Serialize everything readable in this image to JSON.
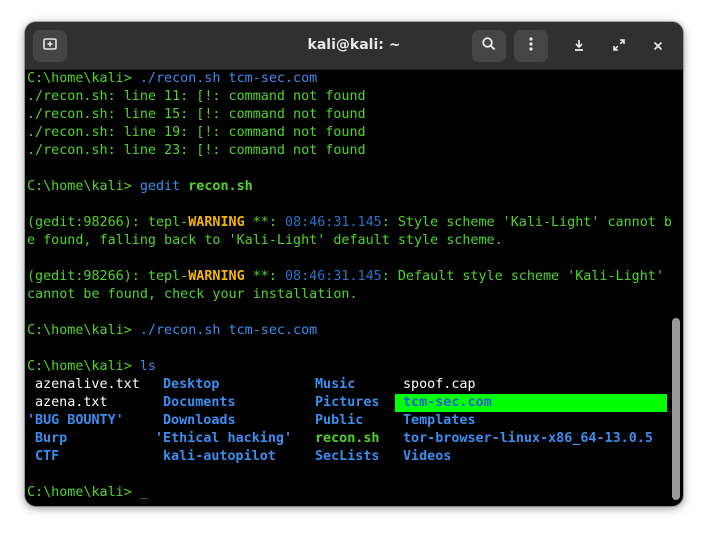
{
  "window": {
    "title": "kali@kali: ~"
  },
  "toolbar": {
    "new_tab_icon": "new-tab-icon",
    "search_icon": "search-icon",
    "menu_icon": "kebab-menu-icon",
    "minimize_icon": "minimize-icon",
    "maximize_icon": "maximize-icon",
    "close_icon": "close-icon"
  },
  "terminal": {
    "prompt": "C:\\home\\kali> ",
    "cmd1": "./recon.sh tcm-sec.com",
    "err1": "./recon.sh: line 11: [!: command not found",
    "err2": "./recon.sh: line 15: [!: command not found",
    "err3": "./recon.sh: line 19: [!: command not found",
    "err4": "./recon.sh: line 23: [!: command not found",
    "cmd2_a": "gedit ",
    "cmd2_b": "recon.sh",
    "w1_pre": "(gedit:98266): tepl-",
    "w1_warn": "WARNING",
    "w1_stars": " **: ",
    "w1_ts": "08:46:31.145",
    "w1_msg": ": Style scheme 'Kali-Light' cannot b",
    "w1_cont": "e found, falling back to 'Kali-Light' default style scheme.",
    "w2_pre": "(gedit:98266): tepl-",
    "w2_warn": "WARNING",
    "w2_stars": " **: ",
    "w2_ts": "08:46:31.145",
    "w2_msg": ": Default style scheme 'Kali-Light'",
    "w2_cont": "cannot be found, check your installation.",
    "cmd3": "./recon.sh tcm-sec.com",
    "cmd4": "ls",
    "cursor_char": "_"
  },
  "ls_listing": {
    "col1": [
      "azenalive.txt",
      "azena.txt",
      "'BUG BOUNTY'",
      "Burp",
      "CTF"
    ],
    "col2": [
      "Desktop",
      "Documents",
      "Downloads",
      "'Ethical hacking'",
      "kali-autopilot"
    ],
    "col3": [
      "Music",
      "Pictures",
      "Public",
      "recon.sh",
      "SecLists"
    ],
    "col4": [
      "spoof.cap",
      "tcm-sec.com",
      "Templates",
      "tor-browser-linux-x86_64-13.0.5",
      "Videos"
    ]
  },
  "colors": {
    "prompt_green": "#4fd52b",
    "dir_blue": "#3a8ef0",
    "warning_yellow": "#f5b800",
    "highlight_bg": "#00ff00",
    "titlebar": "#303030",
    "terminal_bg": "#000000"
  }
}
